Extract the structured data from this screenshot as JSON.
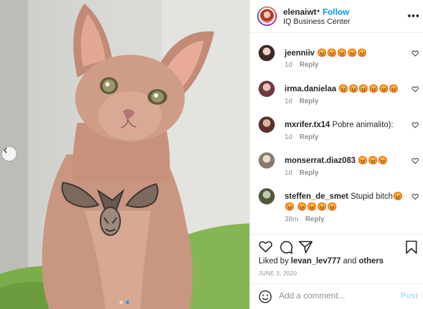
{
  "post": {
    "username": "elenaiwt",
    "separator": "•",
    "follow_label": "Follow",
    "location": "IQ Business Center",
    "more_label": "•••"
  },
  "comments": [
    {
      "user": "jeenniiv",
      "text": "😡😡😡😡😡",
      "time": "1d",
      "reply": "Reply"
    },
    {
      "user": "irma.danielaa",
      "text": "😡😡😡😡😡😡",
      "time": "1d",
      "reply": "Reply"
    },
    {
      "user": "mxrifer.tx14",
      "text": "Pobre animalito):",
      "time": "1d",
      "reply": "Reply"
    },
    {
      "user": "monserrat.diaz083",
      "text": "😡😡😡",
      "time": "1d",
      "reply": "Reply"
    },
    {
      "user": "steffen_de_smet",
      "text": "Stupid bitch😡😡 😡😡😡😡",
      "time": "38m",
      "reply": "Reply"
    }
  ],
  "likes": {
    "prefix": "Liked by",
    "user": "levan_lev777",
    "and": "and",
    "others": "others"
  },
  "date": "JUNE 3, 2020",
  "add_comment": {
    "placeholder": "Add a comment...",
    "post_label": "Post"
  },
  "carousel": {
    "slide_count": 2,
    "active_index": 1
  },
  "colors": {
    "accent": "#0095f6",
    "post_disabled": "#b2dffc",
    "meta_gray": "#8e8e8e",
    "carousel_active": "#3897f0"
  },
  "icons": {
    "heart": "heart-icon",
    "comment": "comment-icon",
    "share": "share-icon",
    "save": "bookmark-icon",
    "emoji": "emoji-icon",
    "prev": "chevron-left-icon"
  }
}
